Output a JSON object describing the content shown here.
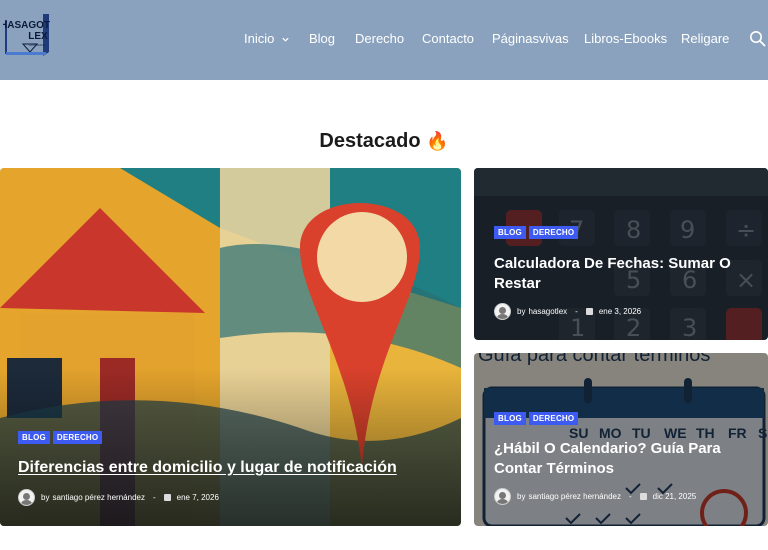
{
  "header": {
    "logo_lines": [
      "HASAGOT",
      "LEX"
    ],
    "logo_small": "GONTRACT",
    "nav": [
      {
        "label": "Inicio",
        "has_dropdown": true
      },
      {
        "label": "Blog"
      },
      {
        "label": "Derecho"
      },
      {
        "label": "Contacto"
      },
      {
        "label": "Páginasvivas"
      },
      {
        "label": "Libros-Ebooks"
      },
      {
        "label": "Religare"
      }
    ],
    "search_icon": "search-icon",
    "background": "#8aa2bd"
  },
  "section": {
    "title": "Destacado",
    "icon": "fire-emoji",
    "icon_char": "🔥"
  },
  "posts": [
    {
      "tags": [
        "BLOG",
        "DERECHO"
      ],
      "title": "Diferencias entre domicilio y lugar de notificación",
      "author_prefix": "by",
      "author": "santiago pérez hernández",
      "date": "ene 7, 2026"
    },
    {
      "tags": [
        "BLOG",
        "DERECHO"
      ],
      "title": "Calculadora De Fechas: Sumar O Restar",
      "author_prefix": "by",
      "author": "hasagotlex",
      "date": "ene 3, 2026",
      "image_keys": [
        "7",
        "8",
        "9",
        "÷",
        "5",
        "6",
        "×",
        "1",
        "2",
        "3"
      ]
    },
    {
      "tags": [
        "BLOG",
        "DERECHO"
      ],
      "title": "¿Hábil O Calendario? Guía Para Contar Términos",
      "author_prefix": "by",
      "author": "santiago pérez hernández",
      "date": "dic 21, 2025",
      "image_heading": "Guía para contar términos",
      "image_weekdays": [
        "SU",
        "MO",
        "TU",
        "WE",
        "TH",
        "FR",
        "SA"
      ]
    }
  ],
  "colors": {
    "tag": "#3d5af1",
    "title_text": "#1b1b1b"
  }
}
